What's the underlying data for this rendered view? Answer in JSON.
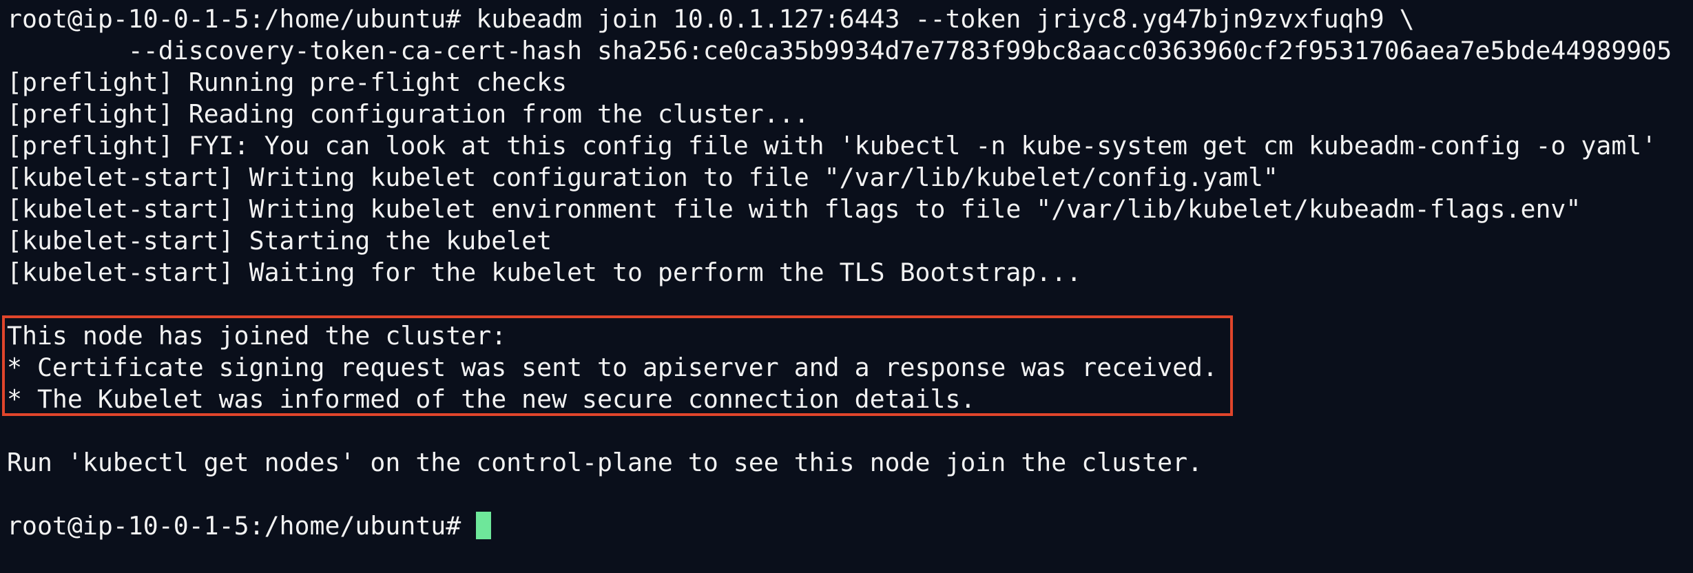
{
  "terminal": {
    "lines": [
      "root@ip-10-0-1-5:/home/ubuntu# kubeadm join 10.0.1.127:6443 --token jriyc8.yg47bjn9zvxfuqh9 \\",
      "        --discovery-token-ca-cert-hash sha256:ce0ca35b9934d7e7783f99bc8aacc0363960cf2f9531706aea7e5bde44989905",
      "[preflight] Running pre-flight checks",
      "[preflight] Reading configuration from the cluster...",
      "[preflight] FYI: You can look at this config file with 'kubectl -n kube-system get cm kubeadm-config -o yaml'",
      "[kubelet-start] Writing kubelet configuration to file \"/var/lib/kubelet/config.yaml\"",
      "[kubelet-start] Writing kubelet environment file with flags to file \"/var/lib/kubelet/kubeadm-flags.env\"",
      "[kubelet-start] Starting the kubelet",
      "[kubelet-start] Waiting for the kubelet to perform the TLS Bootstrap...",
      "",
      "This node has joined the cluster:",
      "* Certificate signing request was sent to apiserver and a response was received.",
      "* The Kubelet was informed of the new secure connection details.",
      "",
      "Run 'kubectl get nodes' on the control-plane to see this node join the cluster.",
      ""
    ],
    "prompt": "root@ip-10-0-1-5:/home/ubuntu# ",
    "colors": {
      "background": "#0a0f1b",
      "text": "#f2f2f2",
      "highlight_border": "#e0452b",
      "cursor": "#6ee79a"
    }
  }
}
